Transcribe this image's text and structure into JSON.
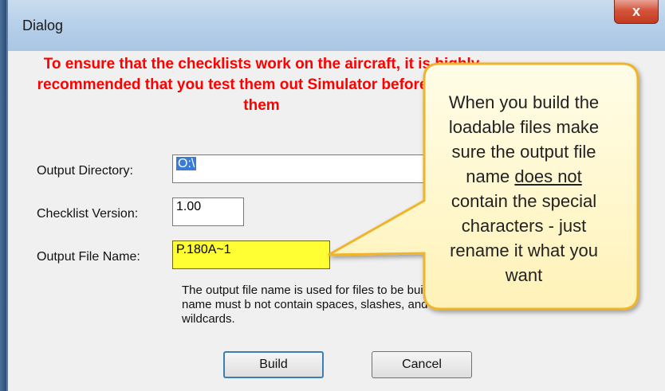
{
  "window": {
    "title": "Dialog",
    "close_glyph": "x"
  },
  "warning": "To ensure that the checklists work on the aircraft, it is highly recommended that you test them out Simulator before loading them",
  "fields": {
    "output_directory": {
      "label": "Output Directory:",
      "value": "O:\\"
    },
    "checklist_version": {
      "label": "Checklist Version:",
      "value": "1.00"
    },
    "output_file_name": {
      "label": "Output File Name:",
      "value": "P.180A~1"
    }
  },
  "help_text": "The output file name is used for files to be built.  The name must b not contain spaces, slashes, and wildcards.",
  "buttons": {
    "build": "Build",
    "cancel": "Cancel"
  },
  "callout": {
    "line1": "When you build the",
    "line2": "loadable files make",
    "line3": "sure the output file",
    "line4_pre": "name ",
    "line4_underline": "does not",
    "line5": "contain the special",
    "line6": "characters - just",
    "line7": "rename it what you",
    "line8": "want"
  },
  "colors": {
    "warning": "#ff0000",
    "callout_fill": "#fff6c8",
    "callout_border": "#f0b429",
    "highlight": "#ffff33"
  }
}
